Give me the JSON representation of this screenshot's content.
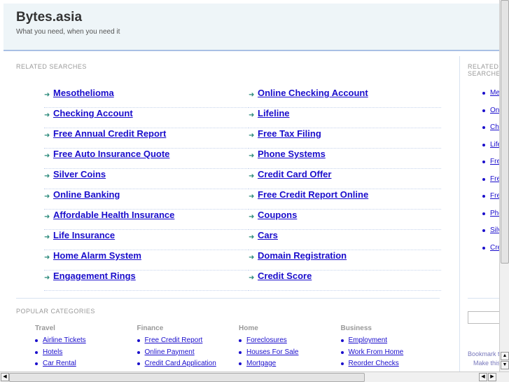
{
  "header": {
    "title": "Bytes.asia",
    "tagline": "What you need, when you need it"
  },
  "related": {
    "label": "RELATED SEARCHES",
    "left": [
      "Mesothelioma",
      "Checking Account",
      "Free Annual Credit Report",
      "Free Auto Insurance Quote",
      "Silver Coins",
      "Online Banking",
      "Affordable Health Insurance",
      "Life Insurance",
      "Home Alarm System",
      "Engagement Rings"
    ],
    "right": [
      "Online Checking Account",
      "Lifeline",
      "Free Tax Filing",
      "Phone Systems",
      "Credit Card Offer",
      "Free Credit Report Online",
      "Coupons",
      "Cars",
      "Domain Registration",
      "Credit Score"
    ]
  },
  "popular": {
    "label": "POPULAR CATEGORIES",
    "categories": [
      {
        "title": "Travel",
        "links": [
          "Airline Tickets",
          "Hotels",
          "Car Rental"
        ]
      },
      {
        "title": "Finance",
        "links": [
          "Free Credit Report",
          "Online Payment",
          "Credit Card Application"
        ]
      },
      {
        "title": "Home",
        "links": [
          "Foreclosures",
          "Houses For Sale",
          "Mortgage"
        ]
      },
      {
        "title": "Business",
        "links": [
          "Employment",
          "Work From Home",
          "Reorder Checks"
        ]
      }
    ]
  },
  "sidebar": {
    "label": "RELATED SEARCHES",
    "links": [
      "Mesothelioma",
      "Online Checking Account",
      "Checking Account",
      "Lifeline",
      "Free Annual Credit Report",
      "Free Tax Filing",
      "Free Auto Insurance Quote",
      "Phone Systems",
      "Silver Coins",
      "Credit Card Offer"
    ],
    "bookmark": "Bookmark this page",
    "homepage": "Make this your Homepage"
  }
}
